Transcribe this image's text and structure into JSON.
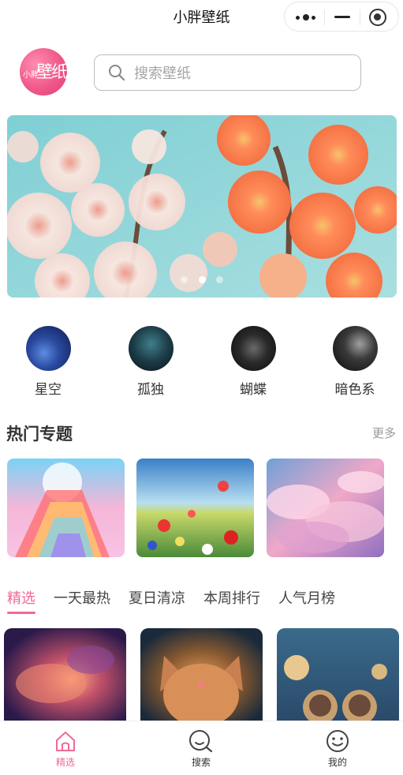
{
  "titlebar": {
    "title": "小胖壁纸"
  },
  "logo": {
    "text_small": "小胖",
    "text_big": "壁纸"
  },
  "search": {
    "placeholder": "搜索壁纸",
    "icon": "search-icon"
  },
  "banner": {
    "slide_count": 3,
    "active_index": 1
  },
  "categories": [
    {
      "label": "星空"
    },
    {
      "label": "孤独"
    },
    {
      "label": "蝴蝶"
    },
    {
      "label": "暗色系"
    }
  ],
  "hot_topics": {
    "title": "热门专题",
    "more": "更多"
  },
  "tabs": [
    {
      "label": "精选",
      "active": true
    },
    {
      "label": "一天最热",
      "active": false
    },
    {
      "label": "夏日清凉",
      "active": false
    },
    {
      "label": "本周排行",
      "active": false
    },
    {
      "label": "人气月榜",
      "active": false
    }
  ],
  "tabbar": [
    {
      "label": "精选",
      "icon": "home-icon",
      "active": true
    },
    {
      "label": "搜索",
      "icon": "search-face-icon",
      "active": false
    },
    {
      "label": "我的",
      "icon": "smile-face-icon",
      "active": false
    }
  ],
  "colors": {
    "accent": "#ee6b94",
    "text": "#333333",
    "muted": "#999999"
  }
}
